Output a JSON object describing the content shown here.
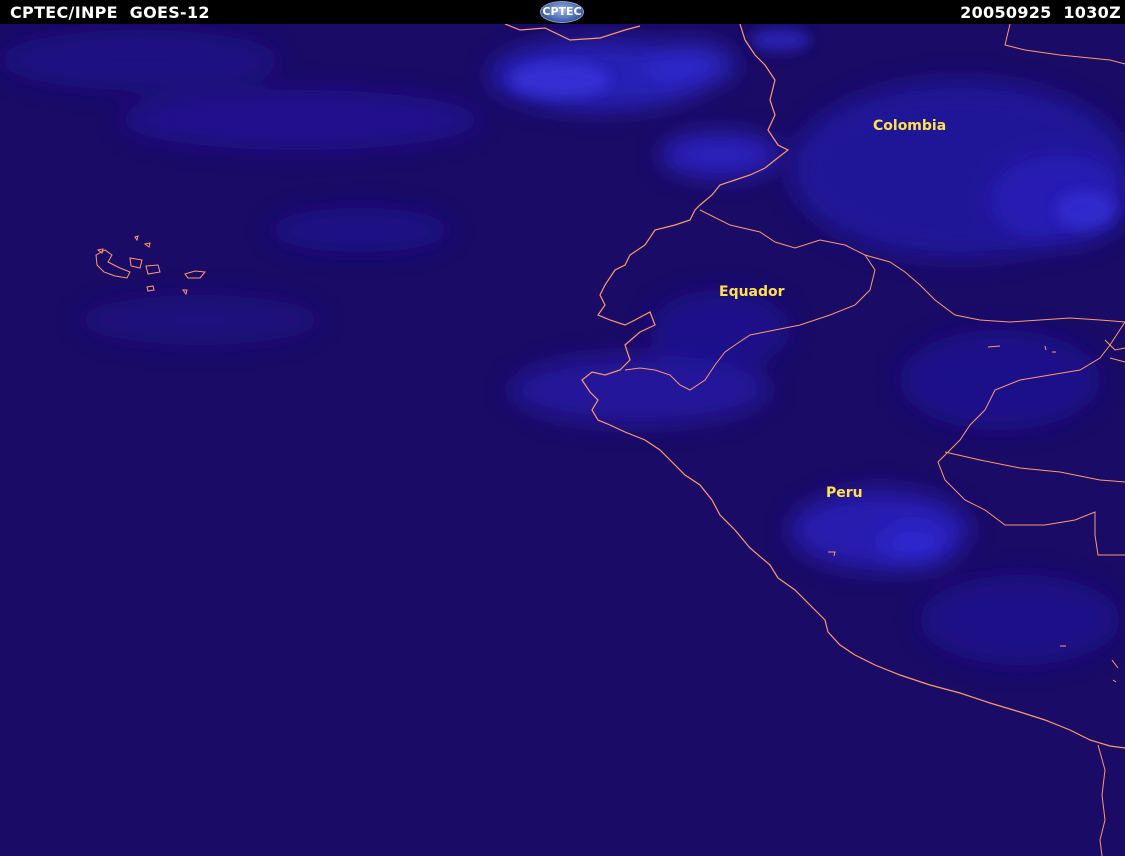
{
  "header": {
    "left_title": "CPTEC/INPE  GOES-12",
    "right_timestamp": "20050925  1030Z",
    "logo_text": "CPTEC"
  },
  "map": {
    "labels": {
      "colombia": "Colombia",
      "equador": "Equador",
      "peru": "Peru"
    },
    "colors": {
      "ocean": "#1a0b66",
      "cloud": "#2a22c8",
      "border": "#ff9a6a",
      "label": "#ffe14f"
    }
  }
}
